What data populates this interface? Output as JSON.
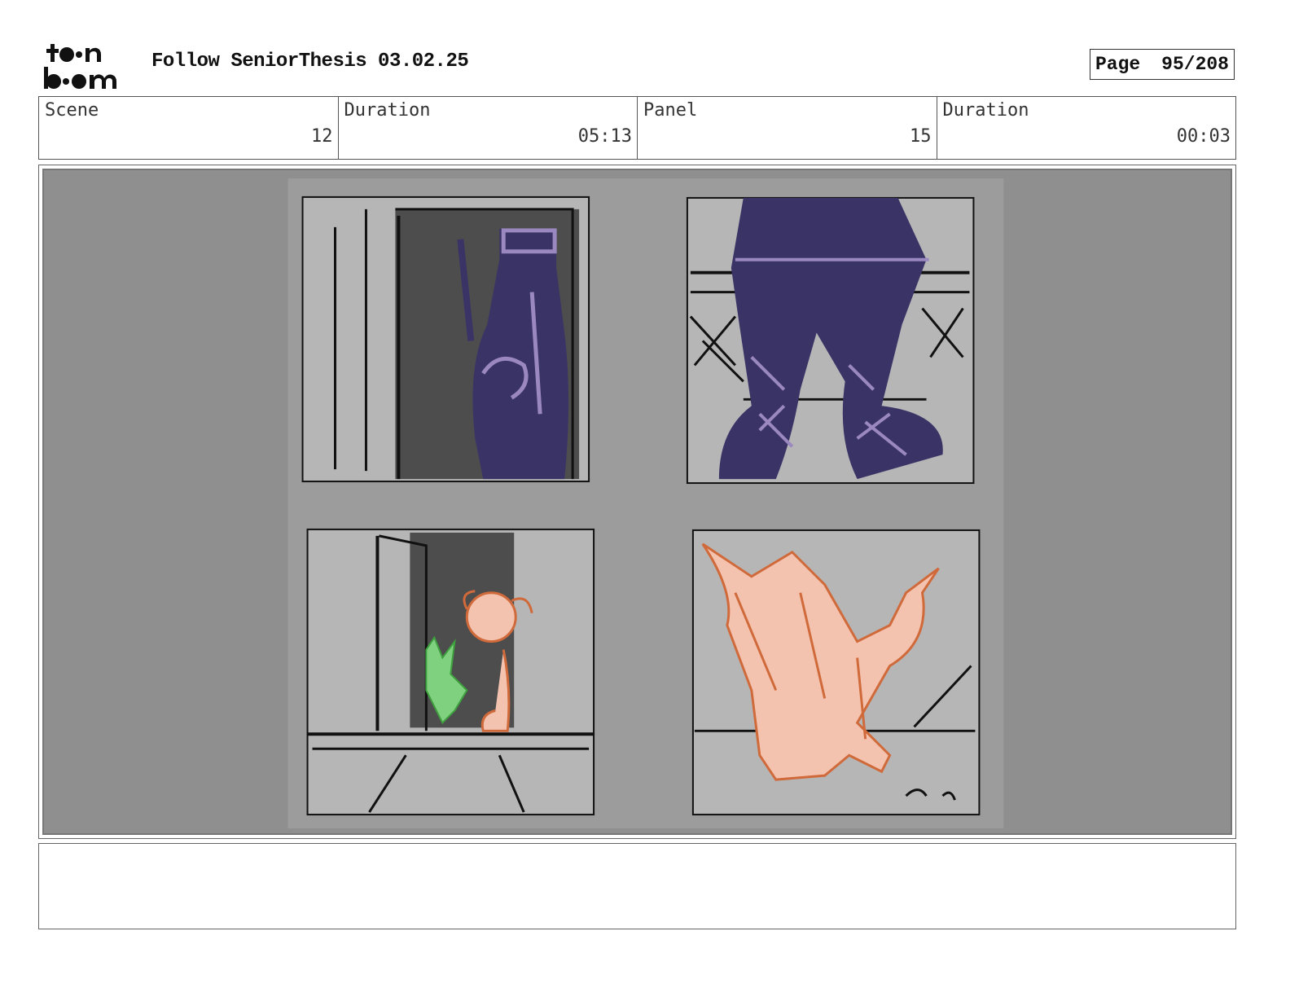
{
  "header": {
    "logo_text": "toonboom",
    "title": "Follow SeniorThesis 03.02.25",
    "page_label": "Page",
    "page_value": "95/208"
  },
  "info": [
    {
      "label": "Scene",
      "value": "12"
    },
    {
      "label": "Duration",
      "value": "05:13"
    },
    {
      "label": "Panel",
      "value": "15"
    },
    {
      "label": "Duration",
      "value": "00:03"
    }
  ],
  "notes": "",
  "colors": {
    "background_gray": "#8f8f8f",
    "panel_gray": "#b4b4b4",
    "dark_interior": "#4a4a4a",
    "purple_figure": "#3a3466",
    "purple_line": "#9b88c0",
    "green_creature": "#7fd07f",
    "peach_character": "#f3c3b0",
    "orange_line": "#d06a3a"
  }
}
